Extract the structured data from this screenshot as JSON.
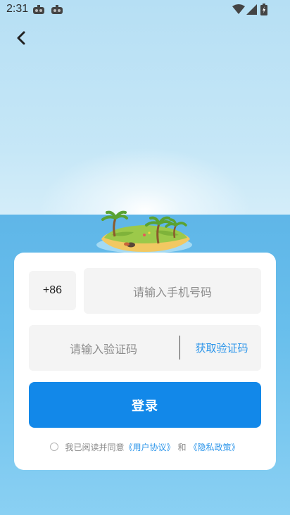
{
  "status_bar": {
    "time": "2:31",
    "icons": [
      "notification-app-icon",
      "notification-app-icon",
      "wifi-icon",
      "cellular-signal-icon",
      "battery-icon"
    ]
  },
  "nav": {
    "back_icon": "chevron-left-icon"
  },
  "login": {
    "country_code": "+86",
    "phone_placeholder": "请输入手机号码",
    "code_placeholder": "请输入验证码",
    "get_code_label": "获取验证码",
    "login_label": "登录",
    "agreement": {
      "prefix": "我已阅读并同意",
      "user_agreement": "《用户协议》",
      "and": "和",
      "privacy_policy": "《隐私政策》",
      "checked": false
    }
  },
  "colors": {
    "accent": "#1288e9",
    "link": "#2b95ea",
    "sky": "#c6e7f7",
    "sea": "#69bfec"
  }
}
